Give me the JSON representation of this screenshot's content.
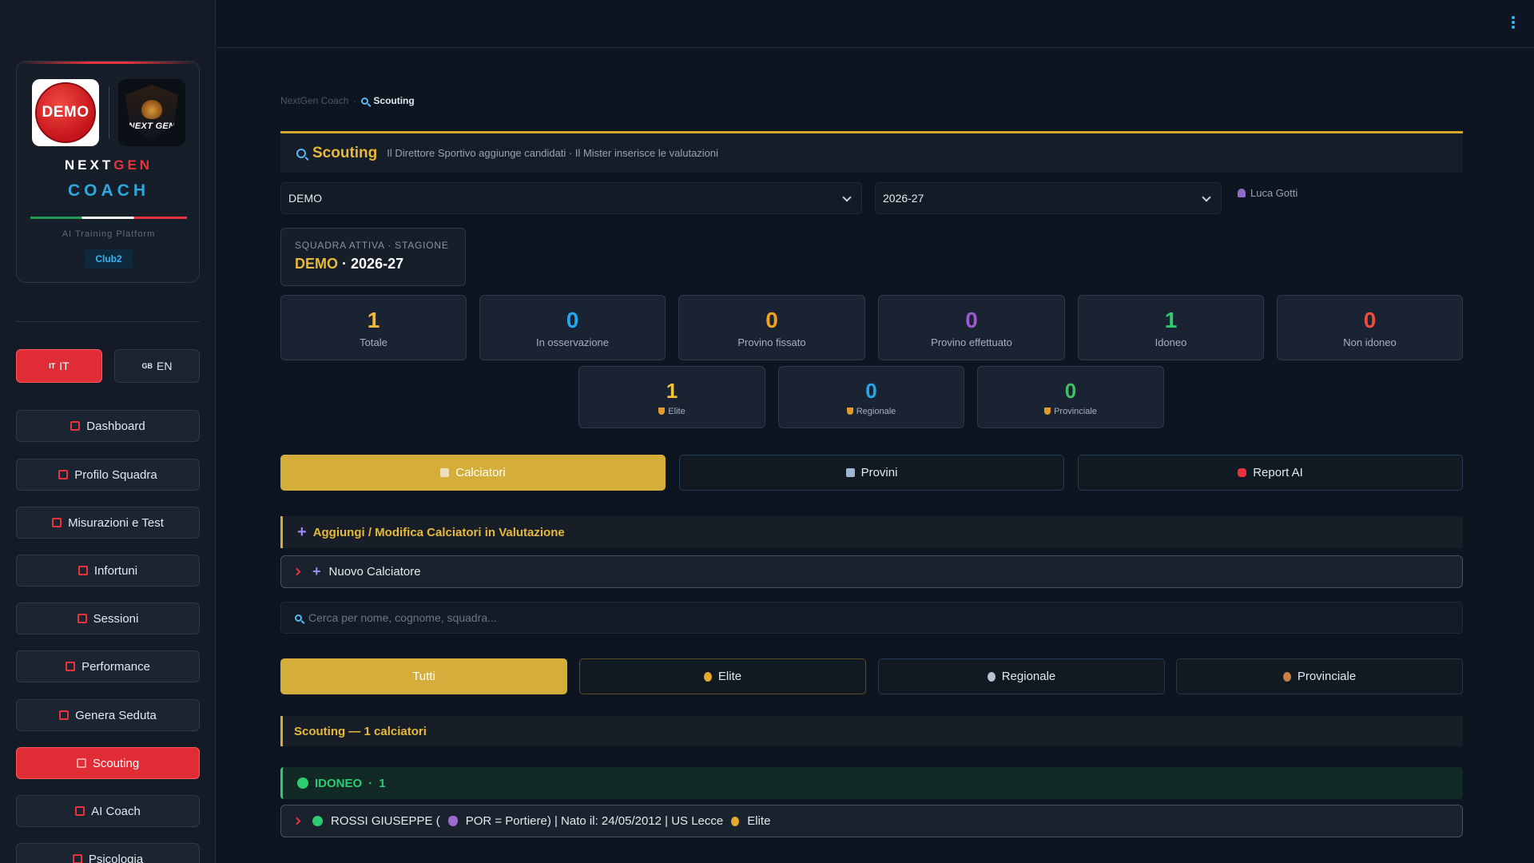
{
  "brand": {
    "logo_demo": "DEMO",
    "logo_nextgen": "NEXT GEN",
    "title_next": "NEXT",
    "title_gen": "GEN",
    "title_coach": "COACH",
    "platform": "AI Training Platform",
    "club": "Club2"
  },
  "lang": {
    "it_flag": "IT",
    "it_label": "IT",
    "en_flag": "GB",
    "en_label": "EN"
  },
  "nav": {
    "items": [
      {
        "label": "Dashboard",
        "icon": "dashboard-icon"
      },
      {
        "label": "Profilo Squadra",
        "icon": "team-icon"
      },
      {
        "label": "Misurazioni e Test",
        "icon": "ruler-icon"
      },
      {
        "label": "Infortuni",
        "icon": "medkit-icon"
      },
      {
        "label": "Sessioni",
        "icon": "calendar-icon"
      },
      {
        "label": "Performance",
        "icon": "chart-icon"
      },
      {
        "label": "Genera Seduta",
        "icon": "lightning-icon"
      },
      {
        "label": "Scouting",
        "icon": "search-icon",
        "active": true
      },
      {
        "label": "AI Coach",
        "icon": "robot-icon"
      },
      {
        "label": "Psicologia",
        "icon": "target-icon"
      }
    ]
  },
  "breadcrumb": {
    "root": "NextGen Coach",
    "sep": "·",
    "current": "Scouting"
  },
  "header": {
    "title": "Scouting",
    "subtitle": "Il Direttore Sportivo aggiunge candidati · Il Mister inserisce le valutazioni"
  },
  "filters": {
    "team": "DEMO",
    "season": "2026-27",
    "user": "Luca Gotti"
  },
  "team_box": {
    "label": "SQUADRA ATTIVA  ·  STAGIONE",
    "team": "DEMO",
    "sep": "·",
    "season": "2026-27"
  },
  "stats": [
    {
      "value": "1",
      "label": "Totale",
      "color": "#f2b63a"
    },
    {
      "value": "0",
      "label": "In osservazione",
      "color": "#1fa8ee"
    },
    {
      "value": "0",
      "label": "Provino fissato",
      "color": "#f0a21f"
    },
    {
      "value": "0",
      "label": "Provino effettuato",
      "color": "#9b59d0"
    },
    {
      "value": "1",
      "label": "Idoneo",
      "color": "#2ecc71"
    },
    {
      "value": "0",
      "label": "Non idoneo",
      "color": "#ef4b3c"
    }
  ],
  "levels": [
    {
      "value": "1",
      "label": "Elite",
      "color": "#f2c43a"
    },
    {
      "value": "0",
      "label": "Regionale",
      "color": "#1fa8ee"
    },
    {
      "value": "0",
      "label": "Provinciale",
      "color": "#3fbf63"
    }
  ],
  "tabs": [
    {
      "label": "Calciatori",
      "active": true
    },
    {
      "label": "Provini"
    },
    {
      "label": "Report AI"
    }
  ],
  "add_section": {
    "title": "Aggiungi / Modifica Calciatori in Valutazione",
    "plus": "+",
    "new_player": "Nuovo Calciatore"
  },
  "search": {
    "placeholder": "Cerca per nome, cognome, squadra..."
  },
  "level_filters": [
    {
      "label": "Tutti",
      "active": true
    },
    {
      "label": "Elite"
    },
    {
      "label": "Regionale"
    },
    {
      "label": "Provinciale"
    }
  ],
  "list": {
    "title": "Scouting — 1 calciatori",
    "group_label": "IDONEO",
    "group_sep": "·",
    "group_count": "1",
    "players": [
      {
        "name_part": "ROSSI GIUSEPPE (",
        "role_part": "POR = Portiere) | Nato il: 24/05/2012 | US Lecce",
        "level": "Elite"
      }
    ]
  }
}
